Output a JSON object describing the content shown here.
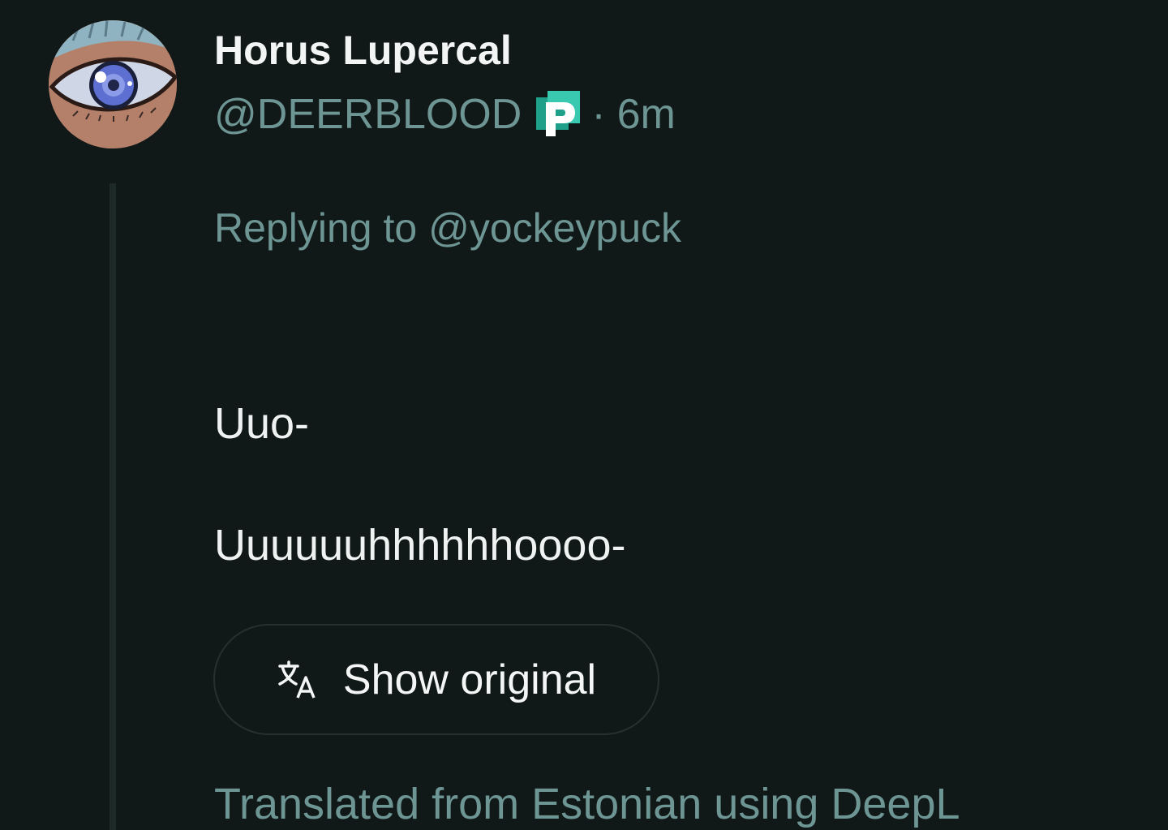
{
  "author": {
    "display_name": "Horus Lupercal",
    "handle": "@DEERBLOOD",
    "badge_icon": "pixelfed-p-icon",
    "separator": "·",
    "timestamp": "6m"
  },
  "reply": {
    "prefix": "Replying to",
    "target": "@yockeypuck"
  },
  "content": {
    "lines": [
      "Uuo-",
      "Uuuuuuhhhhhhoooo-"
    ]
  },
  "translation": {
    "button_label": "Show original",
    "note": "Translated from Estonian using DeepL"
  },
  "colors": {
    "background": "#111918",
    "muted_text": "#6d9593",
    "primary_text": "#f2f5f4",
    "badge_accent": "#1fa08a"
  }
}
